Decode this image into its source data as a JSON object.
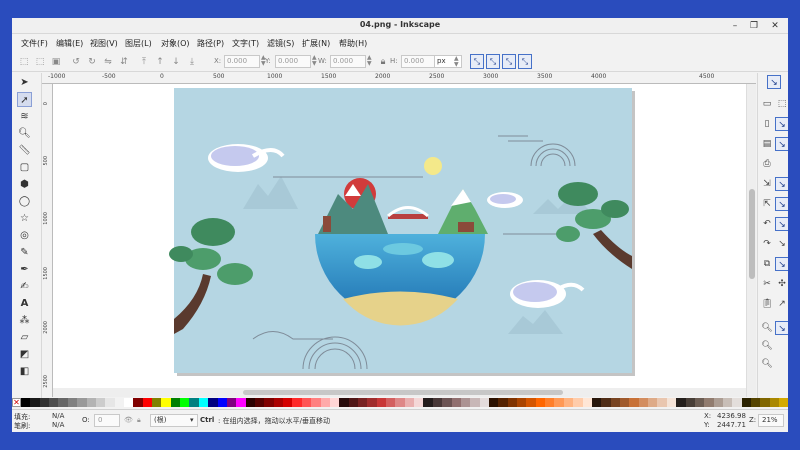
{
  "window": {
    "title": "04.png - Inkscape"
  },
  "menu": [
    "文件(F)",
    "编辑(E)",
    "视图(V)",
    "图层(L)",
    "对象(O)",
    "路径(P)",
    "文字(T)",
    "滤镜(S)",
    "扩展(N)",
    "帮助(H)"
  ],
  "toolbar": {
    "x_label": "X:",
    "x_value": "0.000",
    "y_label": "Y:",
    "y_value": "0.000",
    "w_label": "W:",
    "w_value": "0.000",
    "h_label": "H:",
    "h_value": "0.000",
    "unit": "px"
  },
  "ruler": {
    "h_ticks": [
      "-1000",
      "-500",
      "0",
      "500",
      "1000",
      "1500",
      "2000",
      "2500",
      "3000",
      "3500",
      "4000",
      "4500"
    ],
    "v_ticks": [
      "0",
      "500",
      "1000",
      "1500",
      "2000",
      "2500"
    ]
  },
  "status": {
    "fill_label": "填充:",
    "fill_value": "N/A",
    "stroke_label": "笔刷:",
    "stroke_value": "N/A",
    "opacity_label": "O:",
    "opacity_value": "0",
    "layer": "(根)",
    "message_key": "Ctrl",
    "message": ": 在组内选择，拖动以水平/垂直移动",
    "x_label": "X:",
    "x_value": "4236.98",
    "y_label": "Y:",
    "y_value": "2447.71",
    "z_label": "Z:",
    "zoom": "21%"
  },
  "palette": [
    "#000000",
    "#1a1a1a",
    "#333333",
    "#4d4d4d",
    "#666666",
    "#808080",
    "#999999",
    "#b3b3b3",
    "#cccccc",
    "#e6e6e6",
    "#f2f2f2",
    "#ffffff",
    "#800000",
    "#ff0000",
    "#808000",
    "#ffff00",
    "#008000",
    "#00ff00",
    "#008080",
    "#00ffff",
    "#000080",
    "#0000ff",
    "#800080",
    "#ff00ff",
    "#2b0000",
    "#550000",
    "#800000",
    "#aa0000",
    "#d40000",
    "#ff2a2a",
    "#ff5555",
    "#ff8080",
    "#ffaaaa",
    "#ffd5d5",
    "#280b0b",
    "#501616",
    "#782121",
    "#a02c2c",
    "#c83737",
    "#d35f5f",
    "#de8787",
    "#e9afaf",
    "#f4d7d7",
    "#241c1c",
    "#483737",
    "#6c5353",
    "#916f6f",
    "#ac9393",
    "#c8b7b7",
    "#e3dbdb",
    "#2b1100",
    "#552200",
    "#803300",
    "#aa4400",
    "#d45500",
    "#ff6600",
    "#ff7f2a",
    "#ff9955",
    "#ffb380",
    "#ffccaa",
    "#ffe6d5",
    "#28170b",
    "#502d16",
    "#784421",
    "#a05a2c",
    "#c87137",
    "#d38d5f",
    "#deaa87",
    "#e9c6af",
    "#f4e3d7",
    "#241f1c",
    "#483e37",
    "#6c5d53",
    "#917c6f",
    "#ac9d93",
    "#c8beb7",
    "#e3dedb",
    "#2b2200",
    "#554400",
    "#806600",
    "#aa8800",
    "#d4aa00"
  ]
}
